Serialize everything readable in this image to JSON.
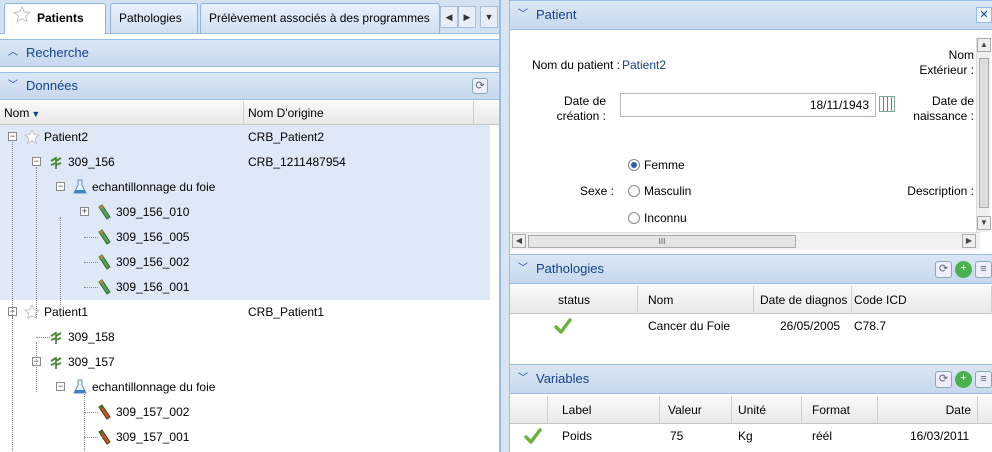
{
  "tabs": {
    "items": [
      {
        "label": "Patients",
        "active": true
      },
      {
        "label": "Pathologies",
        "active": false
      },
      {
        "label": "Prélèvement associés à des programmes",
        "active": false
      }
    ]
  },
  "left": {
    "recherche_label": "Recherche",
    "donnees_label": "Données",
    "grid_columns": [
      "Nom",
      "Nom D'origine"
    ],
    "tree_rows": [
      {
        "label": "Patient2",
        "orig": "CRB_Patient2",
        "icon": "patient-star-icon",
        "level": 0,
        "expand": "−",
        "selected": true
      },
      {
        "label": "309_156",
        "orig": "CRB_1211487954",
        "icon": "sample-plant-icon",
        "level": 1,
        "expand": "−",
        "selected": true
      },
      {
        "label": "echantillonnage du foie",
        "orig": "",
        "icon": "flask-icon",
        "level": 2,
        "expand": "−",
        "selected": true
      },
      {
        "label": "309_156_010",
        "orig": "",
        "icon": "tube-green-icon",
        "level": 3,
        "expand": "+",
        "selected": true
      },
      {
        "label": "309_156_005",
        "orig": "",
        "icon": "tube-green-icon",
        "level": 3,
        "expand": "",
        "selected": true
      },
      {
        "label": "309_156_002",
        "orig": "",
        "icon": "tube-green-icon",
        "level": 3,
        "expand": "",
        "selected": true
      },
      {
        "label": "309_156_001",
        "orig": "",
        "icon": "tube-green-icon",
        "level": 3,
        "expand": "",
        "selected": true
      },
      {
        "label": "Patient1",
        "orig": "CRB_Patient1",
        "icon": "patient-star-icon",
        "level": 0,
        "expand": "−",
        "selected": false
      },
      {
        "label": "309_158",
        "orig": "",
        "icon": "sample-plant-icon",
        "level": 1,
        "expand": "",
        "selected": false
      },
      {
        "label": "309_157",
        "orig": "",
        "icon": "sample-plant-icon",
        "level": 1,
        "expand": "−",
        "selected": false
      },
      {
        "label": "echantillonnage du foie",
        "orig": "",
        "icon": "flask-icon",
        "level": 2,
        "expand": "−",
        "selected": false
      },
      {
        "label": "309_157_002",
        "orig": "",
        "icon": "tube-brown-icon",
        "level": 3,
        "expand": "",
        "selected": false
      },
      {
        "label": "309_157_001",
        "orig": "",
        "icon": "tube-brown-icon",
        "level": 3,
        "expand": "",
        "selected": false
      }
    ]
  },
  "patient": {
    "title": "Patient",
    "nom_label": "Nom du patient :",
    "nom_value": "Patient2",
    "nom_ext_label_1": "Nom",
    "nom_ext_label_2": "Extérieur :",
    "date_creation_label_1": "Date de",
    "date_creation_label_2": "création :",
    "date_creation_value": "18/11/1943",
    "date_naissance_label_1": "Date de",
    "date_naissance_label_2": "naissance :",
    "sexe_label": "Sexe :",
    "sexe_options": [
      "Femme",
      "Masculin",
      "Inconnu"
    ],
    "sexe_selected": "Femme",
    "description_label": "Description :",
    "scroll_grip": "III"
  },
  "pathologies": {
    "title": "Pathologies",
    "columns": [
      "status",
      "Nom",
      "Date de diagnos",
      "Code ICD"
    ],
    "rows": [
      {
        "nom": "Cancer du Foie",
        "date": "26/05/2005",
        "code": "C78.7"
      }
    ]
  },
  "variables": {
    "title": "Variables",
    "columns": [
      "Label",
      "Valeur",
      "Unité",
      "Format",
      "Date"
    ],
    "rows": [
      {
        "label": "Poids",
        "valeur": "75",
        "unite": "Kg",
        "format": "réél",
        "date": "16/03/2011"
      }
    ]
  },
  "colors": {
    "accent": "#15428b",
    "header_bg": "#c7d8ee",
    "selection": "#dfe8f6",
    "check_green": "#6cb33f"
  }
}
